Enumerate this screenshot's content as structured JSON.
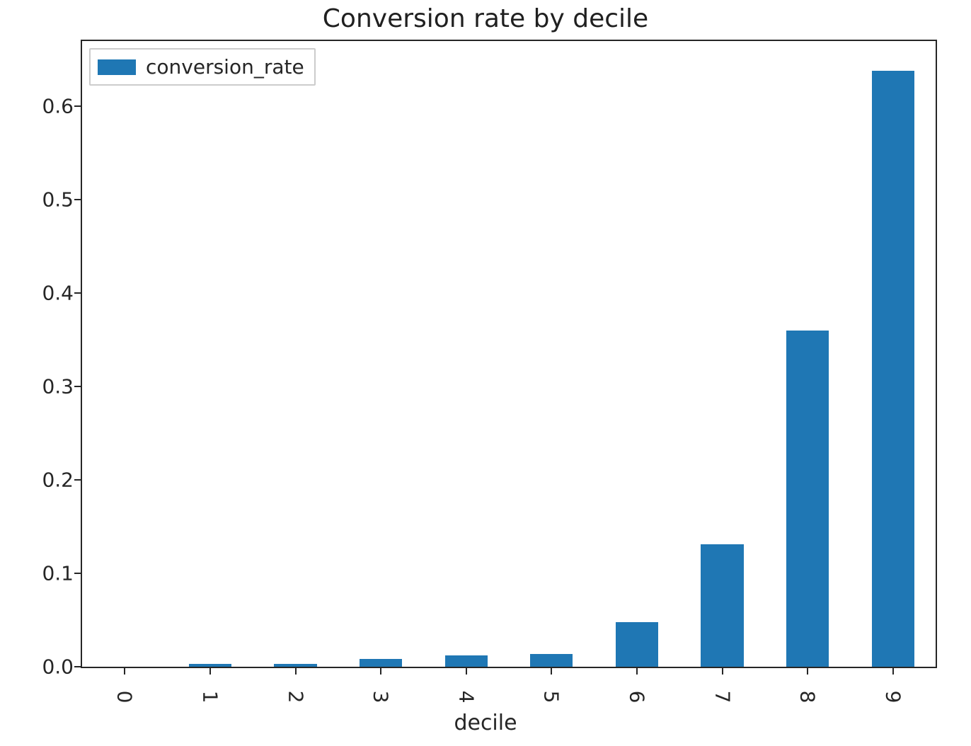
{
  "chart_data": {
    "type": "bar",
    "title": "Conversion rate by decile",
    "xlabel": "decile",
    "ylabel": "",
    "categories": [
      "0",
      "1",
      "2",
      "3",
      "4",
      "5",
      "6",
      "7",
      "8",
      "9"
    ],
    "values": [
      0.0,
      0.003,
      0.003,
      0.008,
      0.012,
      0.014,
      0.048,
      0.131,
      0.36,
      0.638
    ],
    "y_ticks": [
      0.0,
      0.1,
      0.2,
      0.3,
      0.4,
      0.5,
      0.6
    ],
    "y_tick_labels": [
      "0.0",
      "0.1",
      "0.2",
      "0.3",
      "0.4",
      "0.5",
      "0.6"
    ],
    "ylim": [
      0,
      0.67
    ],
    "legend": [
      "conversion_rate"
    ],
    "bar_color": "#1f77b4"
  }
}
